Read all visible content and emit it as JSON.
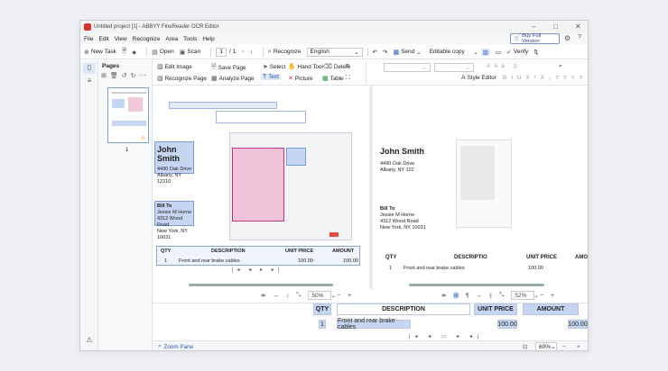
{
  "window": {
    "title": "Untitled project [1] - ABBYY FineReader OCR Editor"
  },
  "menu": [
    "File",
    "Edit",
    "View",
    "Recognize",
    "Area",
    "Tools",
    "Help"
  ],
  "toolbar": {
    "new_task": "New Task",
    "open": "Open",
    "scan": "Scan",
    "page_current": "1",
    "page_total": "/ 1",
    "recognize": "Recognize",
    "language": "English",
    "send": "Send",
    "mode": "Editable copy",
    "verify": "Verify",
    "buy": "Buy Full Version"
  },
  "pages": {
    "title": "Pages",
    "thumb_number": "1"
  },
  "ribbon": {
    "edit_image": "Edit Image",
    "recognize_page": "Recognize Page",
    "save_page": "Save Page",
    "analyze_page": "Analyze Page",
    "select": "Select",
    "hand_tool": "Hand Tool",
    "delete": "Delete",
    "text": "Text",
    "picture": "Picture",
    "table": "Table",
    "style_editor": "Style Editor"
  },
  "document": {
    "name": "John Smith",
    "address1": "4490 Oak Drive",
    "address2": "Albany, NY 12210",
    "bill_to": "Bill To",
    "bill_name": "Jessie M Horne",
    "bill_street": "4312 Wood Road",
    "bill_city": "New York, NY 10031",
    "qty_header": "QTY",
    "desc_header": "DESCRIPTION",
    "price_header": "UNIT PRICE",
    "amount_header": "AMOUNT",
    "row_qty": "1",
    "row_desc": "Front and rear brake cables",
    "row_price": "100.00",
    "row_amount": "100.00",
    "text_desc_header": "DESCRIPTIO",
    "text_amount_header": "AMO",
    "text_address2": "Albany, NY 122"
  },
  "zoom": {
    "image": "50%",
    "text": "52%",
    "bottom": "60%"
  },
  "status": {
    "zoom_pane": "Zoom Pane"
  }
}
